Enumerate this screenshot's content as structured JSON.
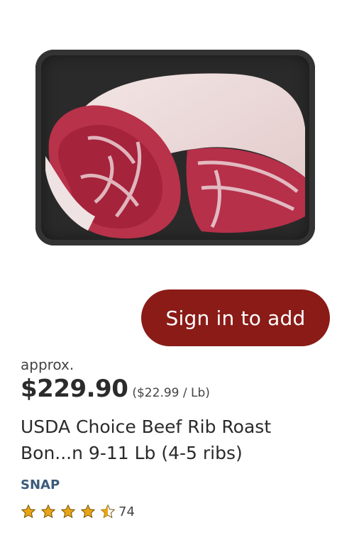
{
  "product": {
    "image_alt": "Beef rib roast on black tray",
    "add_button_label": "Sign in to add",
    "approx_label": "approx.",
    "price": "$229.90",
    "unit_price": "($22.99 / Lb)",
    "title": "USDA Choice Beef Rib Roast Bon...n 9-11 Lb (4-5 ribs)",
    "snap_label": "SNAP",
    "rating": {
      "stars": 4.5,
      "max_stars": 5,
      "review_count": "74"
    }
  },
  "colors": {
    "button": "#8a1b17",
    "star": "#e8a317",
    "snap": "#3b5b7a"
  },
  "icons": [
    "star-icon",
    "half-star-icon"
  ]
}
